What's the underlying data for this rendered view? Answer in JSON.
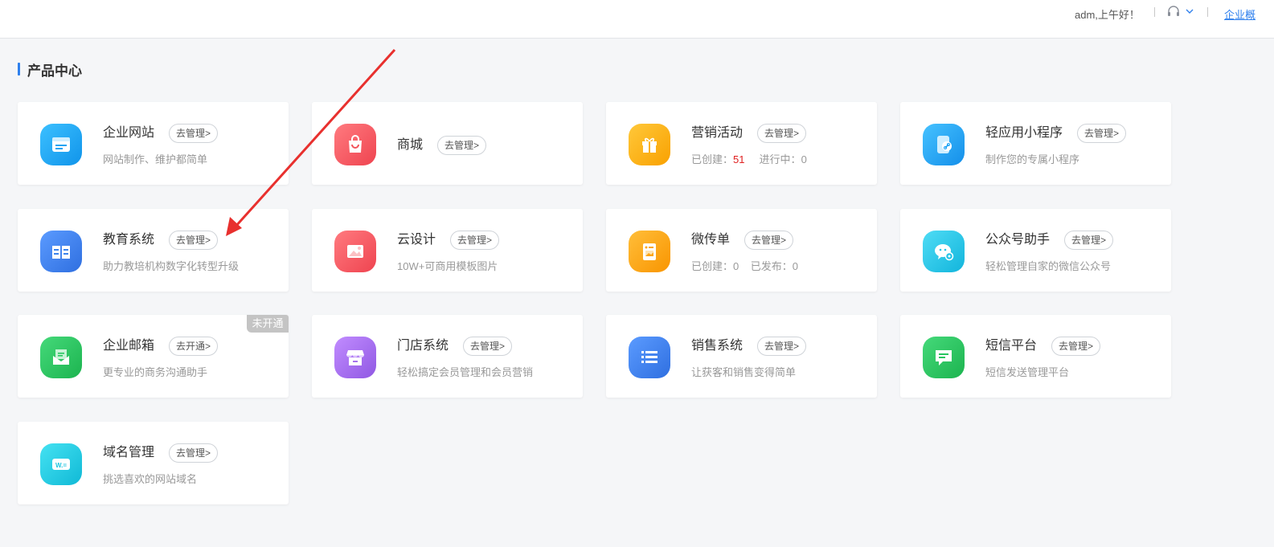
{
  "header": {
    "greeting": "adm,上午好！",
    "overview_link": "企业概",
    "icons": [
      "headset-icon",
      "chevron-down-icon"
    ]
  },
  "section": {
    "title": "产品中心"
  },
  "colors": {
    "accent": "#2f80ed",
    "stat_red": "#e02020",
    "annotation_arrow": "#e8302e"
  },
  "products": [
    {
      "name": "企业网站",
      "button": "去管理>",
      "desc": "网站制作、维护都简单",
      "icon": "website-icon",
      "color": "#1aa3f2"
    },
    {
      "name": "商城",
      "button": "去管理>",
      "icon": "shopping-bag-icon",
      "color": "#f2545b"
    },
    {
      "name": "营销活动",
      "button": "去管理>",
      "stats": {
        "created_label": "已创建：",
        "created_value": "51",
        "active_label": "进行中：",
        "active_value": "0"
      },
      "icon": "gift-icon",
      "color": "#fdb10d"
    },
    {
      "name": "轻应用小程序",
      "button": "去管理>",
      "desc": "制作您的专属小程序",
      "icon": "mini-program-icon",
      "color": "#1ea3f5"
    },
    {
      "name": "教育系统",
      "button": "去管理>",
      "desc": "助力教培机构数字化转型升级",
      "icon": "book-icon",
      "color": "#3b82ec"
    },
    {
      "name": "云设计",
      "button": "去管理>",
      "desc": "10W+可商用模板图片",
      "icon": "image-icon",
      "color": "#f2545b"
    },
    {
      "name": "微传单",
      "button": "去管理>",
      "stats": {
        "created_label": "已创建：",
        "created_value": "0",
        "published_label": "已发布：",
        "published_value": "0"
      },
      "icon": "flyer-icon",
      "color": "#fca516"
    },
    {
      "name": "公众号助手",
      "button": "去管理>",
      "desc": "轻松管理自家的微信公众号",
      "icon": "wechat-settings-icon",
      "color": "#23c5e8"
    },
    {
      "name": "企业邮箱",
      "button": "去开通>",
      "desc": "更专业的商务沟通助手",
      "badge": "未开通",
      "icon": "mail-icon",
      "color": "#27c55f"
    },
    {
      "name": "门店系统",
      "button": "去管理>",
      "desc": "轻松搞定会员管理和会员营销",
      "icon": "store-icon",
      "color": "#a673ec"
    },
    {
      "name": "销售系统",
      "button": "去管理>",
      "desc": "让获客和销售变得简单",
      "icon": "list-icon",
      "color": "#3b82ec"
    },
    {
      "name": "短信平台",
      "button": "去管理>",
      "desc": "短信发送管理平台",
      "icon": "sms-icon",
      "color": "#27c55f"
    },
    {
      "name": "域名管理",
      "button": "去管理>",
      "desc": "挑选喜欢的网站域名",
      "icon": "domain-icon",
      "color": "#1ec6e0"
    }
  ]
}
